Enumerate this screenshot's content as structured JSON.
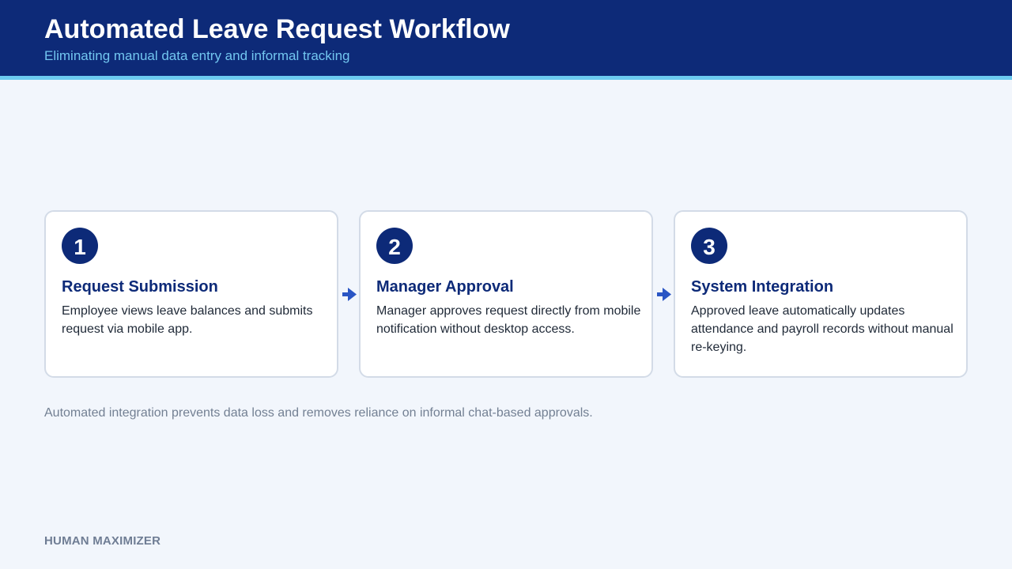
{
  "header": {
    "title": "Automated Leave Request Workflow",
    "subtitle": "Eliminating manual data entry and informal tracking"
  },
  "steps": [
    {
      "number": "1",
      "title": "Request Submission",
      "description": "Employee views leave balances and submits request via mobile app."
    },
    {
      "number": "2",
      "title": "Manager Approval",
      "description": "Manager approves request directly from mobile notification without desktop access."
    },
    {
      "number": "3",
      "title": "System Integration",
      "description": "Approved leave automatically updates attendance and payroll records without manual re-keying."
    }
  ],
  "connector_icons": [
    "arrow-right-icon",
    "arrow-right-icon"
  ],
  "footnote": "Automated integration prevents data loss and removes reliance on informal chat-based approvals.",
  "brand": "HUMAN MAXIMIZER",
  "colors": {
    "header_bg": "#0d2a78",
    "accent": "#6ccbf0",
    "badge_bg": "#0d2a78",
    "arrow": "#2a55c4",
    "page_bg": "#f2f6fc"
  }
}
